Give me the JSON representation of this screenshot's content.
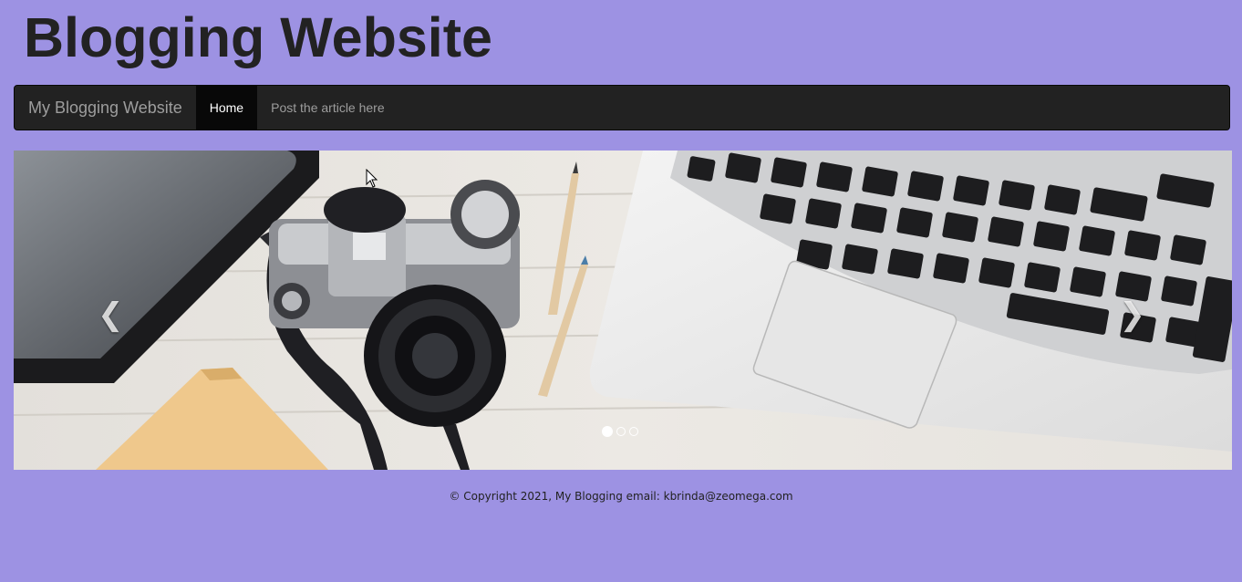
{
  "header": {
    "title": "Blogging Website"
  },
  "navbar": {
    "brand": "My Blogging Website",
    "items": [
      {
        "label": "Home",
        "active": true
      },
      {
        "label": "Post the article here",
        "active": false
      }
    ]
  },
  "carousel": {
    "slide_count": 3,
    "active_index": 0,
    "image": "desk-photo: tablet, camera, pencils, notebook, laptop",
    "prev_icon": "chevron-left-icon",
    "next_icon": "chevron-right-icon"
  },
  "footer": {
    "text": "© Copyright 2021, My Blogging email: kbrinda@zeomega.com"
  },
  "colors": {
    "background": "#9d92e3",
    "navbar": "#222222",
    "active_nav": "#080808"
  }
}
